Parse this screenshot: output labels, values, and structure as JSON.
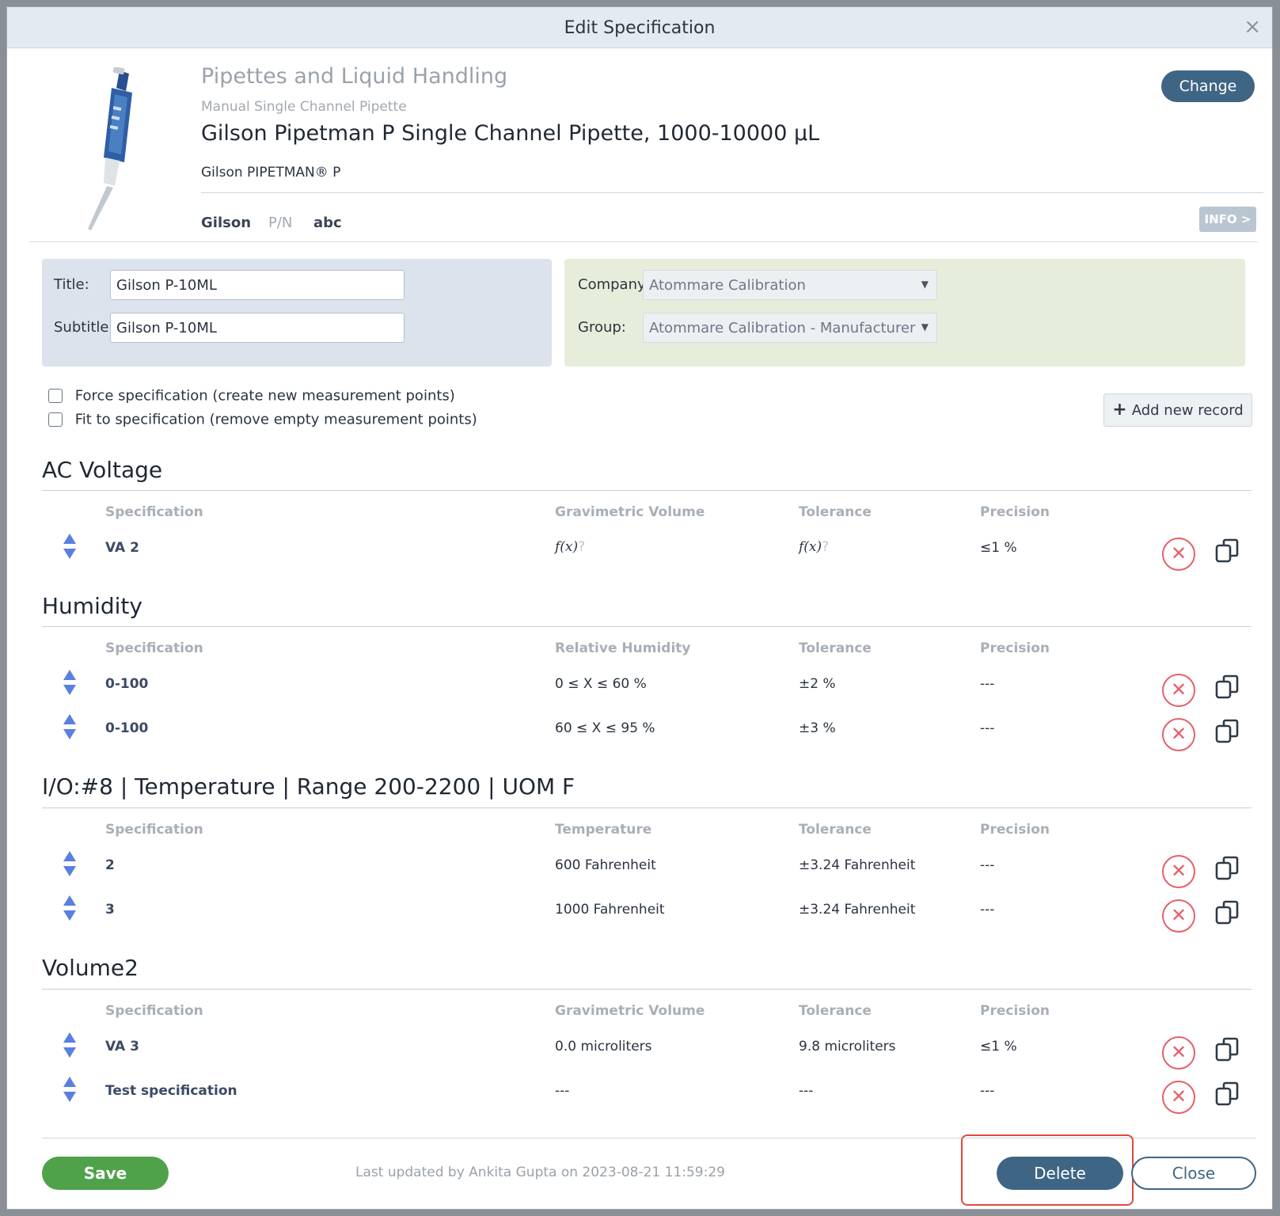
{
  "dialog": {
    "title": "Edit Specification",
    "close_glyph": "×"
  },
  "header": {
    "category": "Pipettes and Liquid Handling",
    "subcategory": "Manual Single Channel Pipette",
    "product": "Gilson Pipetman P Single Channel Pipette, 1000-10000 µL",
    "model": "Gilson PIPETMAN® P",
    "manufacturer": "Gilson",
    "pn_label": "P/N",
    "pn_value": "abc",
    "change_label": "Change",
    "info_label": "INFO >"
  },
  "form": {
    "title_label": "Title:",
    "title_value": "Gilson P-10ML",
    "subtitle_label": "Subtitle:",
    "subtitle_value": "Gilson P-10ML",
    "company_label": "Company:",
    "company_value": "Atommare Calibration",
    "group_label": "Group:",
    "group_value": "Atommare Calibration - Manufacturer"
  },
  "options": {
    "force_label": "Force specification (create new measurement points)",
    "fit_label": "Fit to specification (remove empty measurement points)",
    "add_record_label": "Add new record",
    "add_record_glyph": "+"
  },
  "sections": [
    {
      "title": "AC Voltage",
      "headers": [
        "Specification",
        "Gravimetric Volume",
        "Tolerance",
        "Precision"
      ],
      "rows": [
        {
          "spec": "VA 2",
          "value": "f(x)",
          "tolerance": "f(x)",
          "precision": "≤1 %"
        }
      ]
    },
    {
      "title": "Humidity",
      "headers": [
        "Specification",
        "Relative Humidity",
        "Tolerance",
        "Precision"
      ],
      "rows": [
        {
          "spec": "0-100",
          "value": "0 ≤ X ≤ 60 %",
          "tolerance": "±2 %",
          "precision": "---"
        },
        {
          "spec": "0-100",
          "value": "60 ≤ X ≤ 95 %",
          "tolerance": "±3 %",
          "precision": "---"
        }
      ]
    },
    {
      "title": "I/O:#8 | Temperature | Range 200-2200 | UOM F",
      "headers": [
        "Specification",
        "Temperature",
        "Tolerance",
        "Precision"
      ],
      "rows": [
        {
          "spec": "2",
          "value": "600 Fahrenheit",
          "tolerance": "±3.24 Fahrenheit",
          "precision": "---"
        },
        {
          "spec": "3",
          "value": "1000 Fahrenheit",
          "tolerance": "±3.24 Fahrenheit",
          "precision": "---"
        }
      ]
    },
    {
      "title": "Volume2",
      "headers": [
        "Specification",
        "Gravimetric Volume",
        "Tolerance",
        "Precision"
      ],
      "rows": [
        {
          "spec": "VA 3",
          "value": "0.0 microliters",
          "tolerance": "9.8 microliters",
          "precision": "≤1 %"
        },
        {
          "spec": "Test specification",
          "value": "---",
          "tolerance": "---",
          "precision": "---"
        }
      ]
    }
  ],
  "footer": {
    "save_label": "Save",
    "last_updated": "Last updated by Ankita Gupta on 2023-08-21 11:59:29",
    "delete_label": "Delete",
    "close_label": "Close"
  },
  "colors": {
    "primary": "#3f6585",
    "save": "#4fa24a",
    "danger": "#e5606a",
    "sort": "#5b7fe0",
    "highlight": "#e14a3b"
  }
}
